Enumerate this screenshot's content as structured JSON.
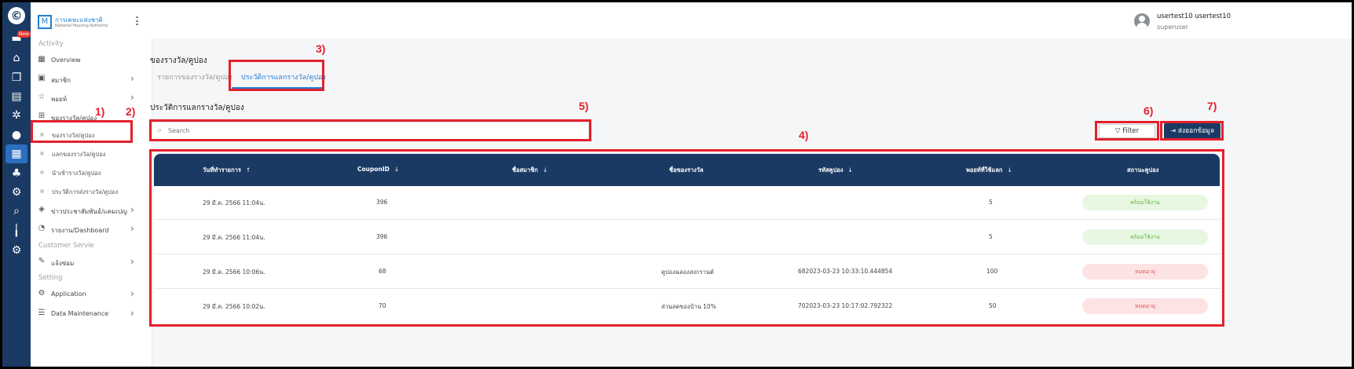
{
  "rail": {
    "badge": "New",
    "icons": [
      "logo-icon",
      "inbox-icon",
      "home-icon",
      "copy-icon",
      "document-icon",
      "settings-icon",
      "user-icon",
      "dashboard-icon",
      "group-icon",
      "gear-icon",
      "search-icon",
      "chart-icon",
      "cogs-icon"
    ]
  },
  "sidebar": {
    "brand_th": "การเคหะแห่งชาติ",
    "brand_en": "National Housing Authority",
    "section_activity": "Activity",
    "overview": "Overview",
    "member": "สมาชิก",
    "points": "พอยท์",
    "rewards": "ของรางวัล/คูปอง",
    "sub_rewards": "ของรางวัล/คูปอง",
    "sub_redeem": "แลกของรางวัล/คูปอง",
    "sub_import": "นำเข้ารางวัล/คูปอง",
    "sub_history": "ประวัติการส่งรางวัล/คูปอง",
    "news": "ข่าวประชาสัมพันธ์/แคมเปญ",
    "report": "รายงาน/Dashboard",
    "section_customer": "Customer Servie",
    "complaint": "แจ้งซ่อม",
    "section_setting": "Setting",
    "application": "Application",
    "data_maintenance": "Data Maintenance"
  },
  "topbar": {
    "user_name": "usertest10 usertest10",
    "user_role": "superuser"
  },
  "main": {
    "page_title": "ของรางวัล/คูปอง",
    "tabs": [
      {
        "label": "รายการของรางวัล/คูปอง"
      },
      {
        "label": "ประวัติการแลกรางวัล/คูปอง"
      }
    ],
    "section_title": "ประวัติการแลกรางวัล/คูปอง",
    "search_placeholder": "Search",
    "filter_label": "Filter",
    "export_label": "ส่งออกข้อมูล"
  },
  "table": {
    "columns": [
      {
        "label": "วันที่ทำรายการ",
        "sort": "↑"
      },
      {
        "label": "CouponID",
        "sort": "↓"
      },
      {
        "label": "ชื่อสมาชิก",
        "sort": "↓"
      },
      {
        "label": "ชื่อของรางวัล",
        "sort": ""
      },
      {
        "label": "รหัสคูปอง",
        "sort": "↓"
      },
      {
        "label": "พอยท์ที่ใช้แลก",
        "sort": "↓"
      },
      {
        "label": "สถานะคูปอง",
        "sort": ""
      }
    ],
    "rows": [
      {
        "date": "29 มี.ค. 2566 11:04น.",
        "coupon_id": "396",
        "member": "",
        "reward": "",
        "code": "",
        "points": "5",
        "status": "พร้อมใช้งาน",
        "status_type": "ok"
      },
      {
        "date": "29 มี.ค. 2566 11:04น.",
        "coupon_id": "396",
        "member": "",
        "reward": "",
        "code": "",
        "points": "5",
        "status": "พร้อมใช้งาน",
        "status_type": "ok"
      },
      {
        "date": "29 มี.ค. 2566 10:06น.",
        "coupon_id": "68",
        "member": "",
        "reward": "คูปองฉลองสงกรานต์",
        "code": "682023-03-23 10:33:10.444854",
        "points": "100",
        "status": "หมดอายุ",
        "status_type": "expired"
      },
      {
        "date": "29 มี.ค. 2566 10:02น.",
        "coupon_id": "70",
        "member": "",
        "reward": "ส่วนลดของบ้าน 10%",
        "code": "702023-03-23 10:17:02.792322",
        "points": "50",
        "status": "หมดอายุ",
        "status_type": "expired"
      }
    ]
  },
  "annotations": [
    "1)",
    "2)",
    "3)",
    "4)",
    "5)",
    "6)",
    "7)"
  ],
  "colors": {
    "navy": "#1a3a64",
    "accent": "#1f7fcf",
    "annotation": "#e4202a",
    "ok_bg": "#e8f7e1",
    "expired_bg": "#fde3e3"
  }
}
